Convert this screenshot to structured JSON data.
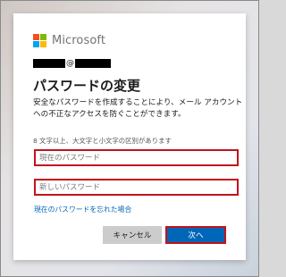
{
  "brand": {
    "name": "Microsoft",
    "logo_colors": [
      "#f25022",
      "#7fba00",
      "#00a4ef",
      "#ffb900"
    ]
  },
  "account": {
    "at": "@"
  },
  "page": {
    "title": "パスワードの変更",
    "description": "安全なパスワードを作成することにより、メール アカウントへの不正なアクセスを防ぐことができます。",
    "requirement_hint": "8 文字以上、大文字と小文字の区別があります"
  },
  "form": {
    "current_password_placeholder": "現在のパスワード",
    "new_password_placeholder": "新しいパスワード",
    "forgot_link": "現在のパスワードを忘れた場合"
  },
  "buttons": {
    "cancel": "キャンセル",
    "next": "次へ"
  },
  "colors": {
    "accent": "#0067b8",
    "highlight_border": "#c4121c",
    "cancel_bg": "#cccccc"
  }
}
